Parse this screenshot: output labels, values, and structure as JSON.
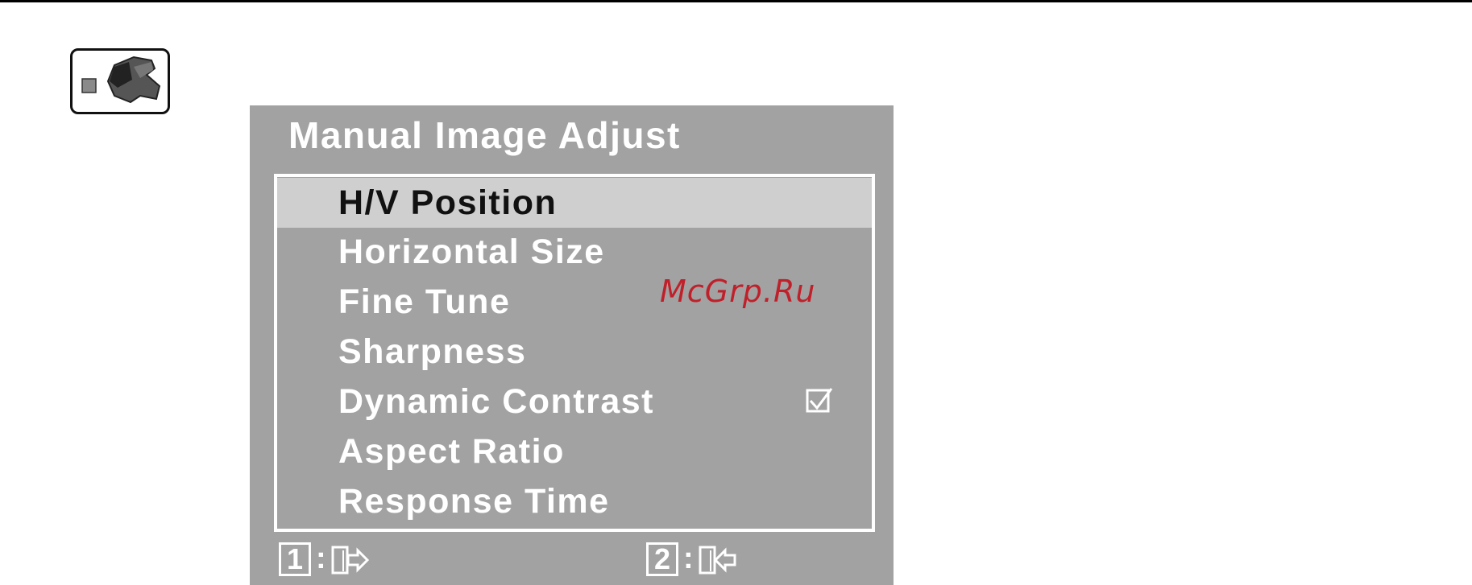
{
  "osd": {
    "title": "Manual Image Adjust",
    "items": [
      {
        "label": "H/V Position",
        "selected": true
      },
      {
        "label": "Horizontal Size"
      },
      {
        "label": "Fine Tune"
      },
      {
        "label": "Sharpness"
      },
      {
        "label": "Dynamic Contrast",
        "checked": true
      },
      {
        "label": "Aspect Ratio"
      },
      {
        "label": "Response Time"
      }
    ],
    "footer": {
      "key1": "1",
      "key1_action": "exit",
      "key2": "2",
      "key2_action": "enter",
      "separator": ":"
    }
  },
  "icons": {
    "menu_icon": "manual-adjust-wrench-icon",
    "checkbox": "checkbox-checked-icon",
    "key1_icon": "exit-door-icon",
    "key2_icon": "enter-door-icon"
  },
  "watermark": "McGrp.Ru",
  "colors": {
    "osd_background": "#a2a2a2",
    "selected_row": "#cfcfcf",
    "text": "#ffffff",
    "watermark": "#c0202a"
  }
}
